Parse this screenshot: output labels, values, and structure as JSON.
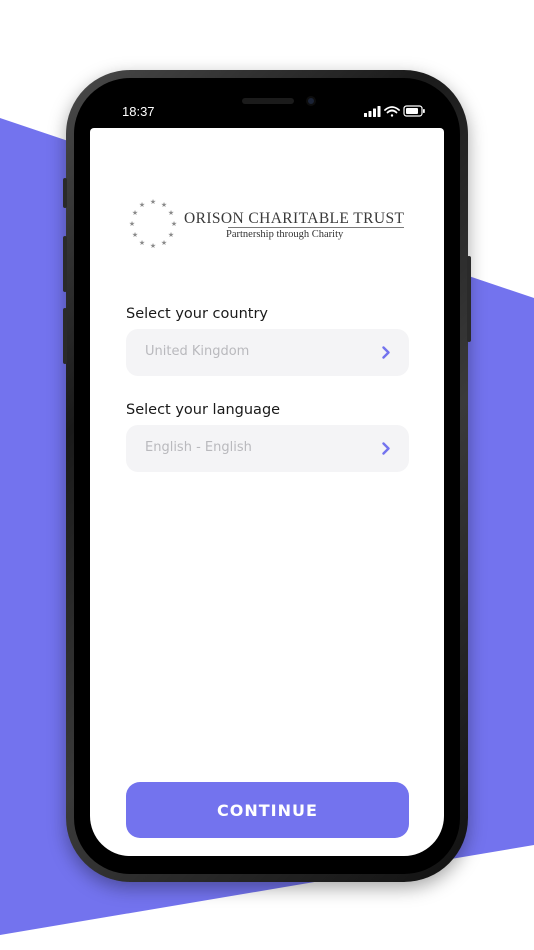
{
  "theme": {
    "accent": "#7373EE",
    "background": "#FFFFFF",
    "field_background": "#F4F4F6",
    "placeholder_text": "#B9B9BD",
    "label_text": "#1A1A1A"
  },
  "status_bar": {
    "time": "18:37",
    "icons": [
      "signal-icon",
      "wifi-icon",
      "battery-icon"
    ]
  },
  "logo": {
    "title": "ORISON CHARITABLE TRUST",
    "tagline": "Partnership through Charity",
    "icon": "star-ring-icon"
  },
  "form": {
    "country": {
      "label": "Select your country",
      "value": "United Kingdom",
      "icon": "chevron-right-icon"
    },
    "language": {
      "label": "Select your language",
      "value": "English - English",
      "icon": "chevron-right-icon"
    }
  },
  "actions": {
    "continue_label": "CONTINUE"
  }
}
